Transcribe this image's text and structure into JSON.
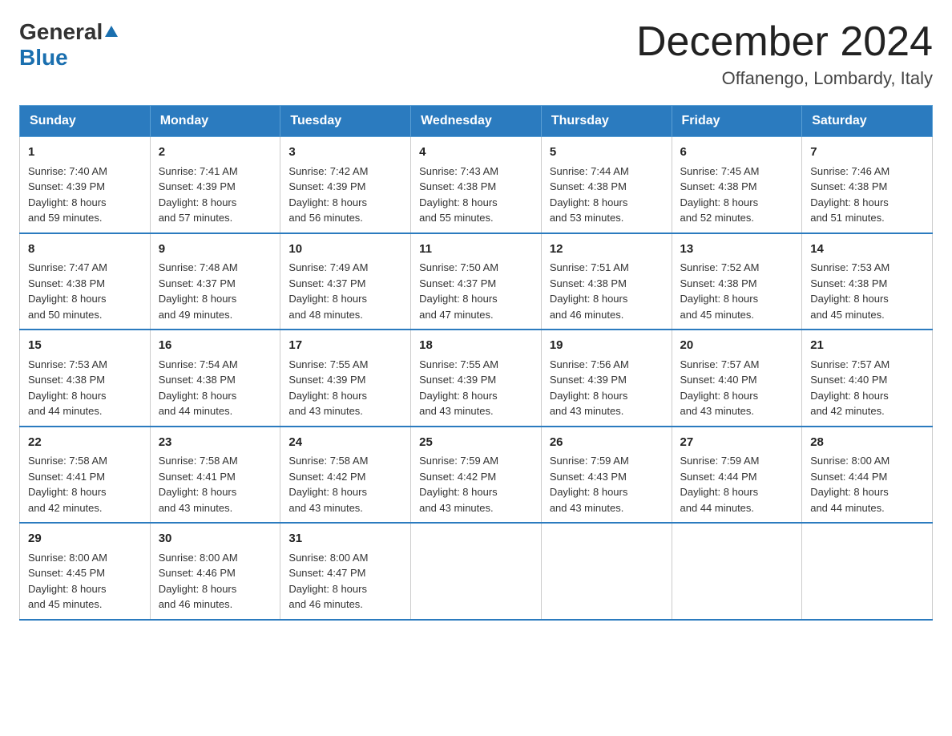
{
  "header": {
    "logo_general": "General",
    "logo_blue": "Blue",
    "title": "December 2024",
    "subtitle": "Offanengo, Lombardy, Italy"
  },
  "days_of_week": [
    "Sunday",
    "Monday",
    "Tuesday",
    "Wednesday",
    "Thursday",
    "Friday",
    "Saturday"
  ],
  "weeks": [
    [
      {
        "date": "1",
        "sunrise": "7:40 AM",
        "sunset": "4:39 PM",
        "daylight": "8 hours and 59 minutes."
      },
      {
        "date": "2",
        "sunrise": "7:41 AM",
        "sunset": "4:39 PM",
        "daylight": "8 hours and 57 minutes."
      },
      {
        "date": "3",
        "sunrise": "7:42 AM",
        "sunset": "4:39 PM",
        "daylight": "8 hours and 56 minutes."
      },
      {
        "date": "4",
        "sunrise": "7:43 AM",
        "sunset": "4:38 PM",
        "daylight": "8 hours and 55 minutes."
      },
      {
        "date": "5",
        "sunrise": "7:44 AM",
        "sunset": "4:38 PM",
        "daylight": "8 hours and 53 minutes."
      },
      {
        "date": "6",
        "sunrise": "7:45 AM",
        "sunset": "4:38 PM",
        "daylight": "8 hours and 52 minutes."
      },
      {
        "date": "7",
        "sunrise": "7:46 AM",
        "sunset": "4:38 PM",
        "daylight": "8 hours and 51 minutes."
      }
    ],
    [
      {
        "date": "8",
        "sunrise": "7:47 AM",
        "sunset": "4:38 PM",
        "daylight": "8 hours and 50 minutes."
      },
      {
        "date": "9",
        "sunrise": "7:48 AM",
        "sunset": "4:37 PM",
        "daylight": "8 hours and 49 minutes."
      },
      {
        "date": "10",
        "sunrise": "7:49 AM",
        "sunset": "4:37 PM",
        "daylight": "8 hours and 48 minutes."
      },
      {
        "date": "11",
        "sunrise": "7:50 AM",
        "sunset": "4:37 PM",
        "daylight": "8 hours and 47 minutes."
      },
      {
        "date": "12",
        "sunrise": "7:51 AM",
        "sunset": "4:38 PM",
        "daylight": "8 hours and 46 minutes."
      },
      {
        "date": "13",
        "sunrise": "7:52 AM",
        "sunset": "4:38 PM",
        "daylight": "8 hours and 45 minutes."
      },
      {
        "date": "14",
        "sunrise": "7:53 AM",
        "sunset": "4:38 PM",
        "daylight": "8 hours and 45 minutes."
      }
    ],
    [
      {
        "date": "15",
        "sunrise": "7:53 AM",
        "sunset": "4:38 PM",
        "daylight": "8 hours and 44 minutes."
      },
      {
        "date": "16",
        "sunrise": "7:54 AM",
        "sunset": "4:38 PM",
        "daylight": "8 hours and 44 minutes."
      },
      {
        "date": "17",
        "sunrise": "7:55 AM",
        "sunset": "4:39 PM",
        "daylight": "8 hours and 43 minutes."
      },
      {
        "date": "18",
        "sunrise": "7:55 AM",
        "sunset": "4:39 PM",
        "daylight": "8 hours and 43 minutes."
      },
      {
        "date": "19",
        "sunrise": "7:56 AM",
        "sunset": "4:39 PM",
        "daylight": "8 hours and 43 minutes."
      },
      {
        "date": "20",
        "sunrise": "7:57 AM",
        "sunset": "4:40 PM",
        "daylight": "8 hours and 43 minutes."
      },
      {
        "date": "21",
        "sunrise": "7:57 AM",
        "sunset": "4:40 PM",
        "daylight": "8 hours and 42 minutes."
      }
    ],
    [
      {
        "date": "22",
        "sunrise": "7:58 AM",
        "sunset": "4:41 PM",
        "daylight": "8 hours and 42 minutes."
      },
      {
        "date": "23",
        "sunrise": "7:58 AM",
        "sunset": "4:41 PM",
        "daylight": "8 hours and 43 minutes."
      },
      {
        "date": "24",
        "sunrise": "7:58 AM",
        "sunset": "4:42 PM",
        "daylight": "8 hours and 43 minutes."
      },
      {
        "date": "25",
        "sunrise": "7:59 AM",
        "sunset": "4:42 PM",
        "daylight": "8 hours and 43 minutes."
      },
      {
        "date": "26",
        "sunrise": "7:59 AM",
        "sunset": "4:43 PM",
        "daylight": "8 hours and 43 minutes."
      },
      {
        "date": "27",
        "sunrise": "7:59 AM",
        "sunset": "4:44 PM",
        "daylight": "8 hours and 44 minutes."
      },
      {
        "date": "28",
        "sunrise": "8:00 AM",
        "sunset": "4:44 PM",
        "daylight": "8 hours and 44 minutes."
      }
    ],
    [
      {
        "date": "29",
        "sunrise": "8:00 AM",
        "sunset": "4:45 PM",
        "daylight": "8 hours and 45 minutes."
      },
      {
        "date": "30",
        "sunrise": "8:00 AM",
        "sunset": "4:46 PM",
        "daylight": "8 hours and 46 minutes."
      },
      {
        "date": "31",
        "sunrise": "8:00 AM",
        "sunset": "4:47 PM",
        "daylight": "8 hours and 46 minutes."
      },
      null,
      null,
      null,
      null
    ]
  ],
  "labels": {
    "sunrise": "Sunrise: ",
    "sunset": "Sunset: ",
    "daylight": "Daylight: "
  }
}
